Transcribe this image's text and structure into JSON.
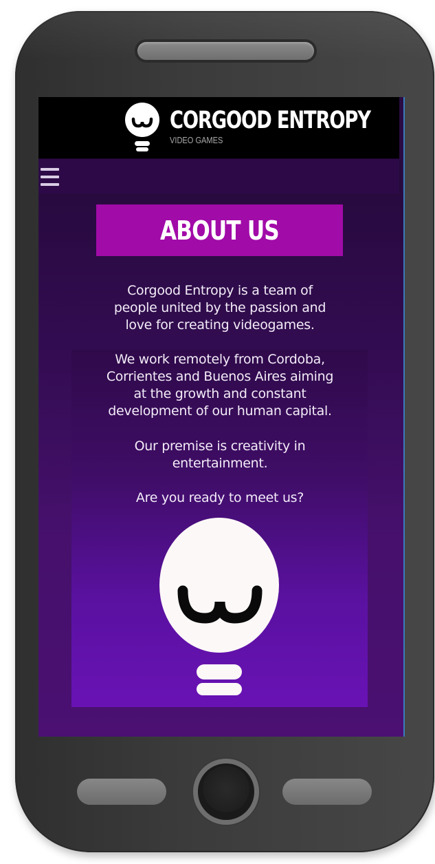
{
  "brand": {
    "name": "CORGOOD ENTROPY",
    "subtitle": "VIDEO GAMES"
  },
  "nav": {
    "menu_icon": "hamburger-menu-icon"
  },
  "about": {
    "title": "ABOUT US",
    "paragraphs": [
      [
        "Corgood Entropy is a team of",
        "people united by the passion and",
        "love for creating videogames."
      ],
      [
        "We work remotely from Cordoba,",
        "Corrientes and Buenos Aires aiming",
        "at the growth and constant",
        "development of our human capital."
      ],
      [
        "Our premise is creativity in",
        "entertainment."
      ],
      [
        "Are you ready to meet us?"
      ]
    ]
  },
  "colors": {
    "header_bg": "#000000",
    "title_bg": "#a10ba8",
    "page_bg": "#2a0c42",
    "panel_bottom": "#6912b5",
    "bulb": "#fdf8f8"
  },
  "icons": [
    "logo-bulb-icon",
    "hamburger-menu-icon",
    "mascot-bulb-icon"
  ]
}
